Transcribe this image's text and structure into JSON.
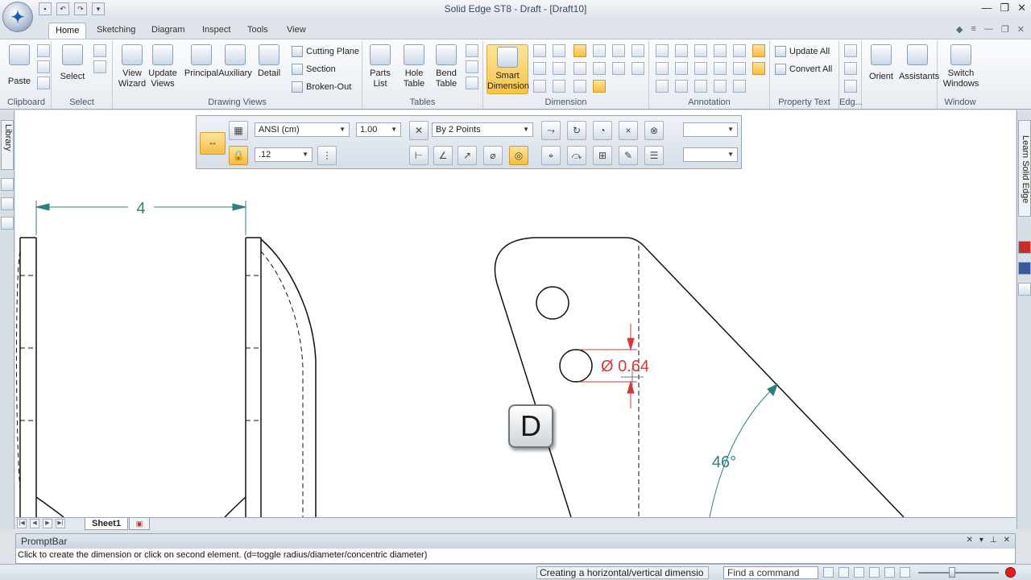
{
  "window": {
    "title": "Solid Edge ST8 - Draft - [Draft10]"
  },
  "tabs": [
    "Home",
    "Sketching",
    "Diagram",
    "Inspect",
    "Tools",
    "View"
  ],
  "ribbon": {
    "clipboard": {
      "paste": "Paste",
      "label": "Clipboard"
    },
    "select": {
      "select": "Select",
      "label": "Select"
    },
    "drawing_views": {
      "view_wizard": "View Wizard",
      "update_views": "Update Views",
      "principal": "Principal",
      "auxiliary": "Auxiliary",
      "detail": "Detail",
      "cutting_plane": "Cutting Plane",
      "section": "Section",
      "broken_out": "Broken-Out",
      "label": "Drawing Views"
    },
    "tables": {
      "parts_list": "Parts List",
      "hole_table": "Hole Table",
      "bend_table": "Bend Table",
      "label": "Tables"
    },
    "dimension": {
      "smart_dimension": "Smart Dimension",
      "label": "Dimension"
    },
    "annotation": {
      "label": "Annotation"
    },
    "property_text": {
      "update_all": "Update All",
      "convert_all": "Convert All",
      "label": "Property Text"
    },
    "edge": {
      "label": "Edg..."
    },
    "orient": {
      "orient": "Orient"
    },
    "assistants": {
      "assistants": "Assistants"
    },
    "window": {
      "switch_windows": "Switch Windows",
      "label": "Window"
    }
  },
  "command_bar": {
    "style": "ANSI (cm)",
    "scale": "1.00",
    "precision": ".12",
    "method": "By 2 Points"
  },
  "side": {
    "library": "Library",
    "learn": "Learn Solid Edge"
  },
  "drawing": {
    "dim_width": "4",
    "dim_diameter": "Ø 0.64",
    "dim_angle": "46°",
    "colors": {
      "dimension": "#2f7f7f",
      "active_dimension": "#d23a3a",
      "geometry": "#111111"
    }
  },
  "sheet": {
    "tab": "Sheet1"
  },
  "prompt": {
    "title": "PromptBar",
    "text": "Click to create the dimension or click on second element. (d=toggle radius/diameter/concentric diameter)"
  },
  "status": {
    "message": "Creating a horizontal/vertical dimensio",
    "find_placeholder": "Find a command"
  },
  "overlay": {
    "key": "D"
  }
}
